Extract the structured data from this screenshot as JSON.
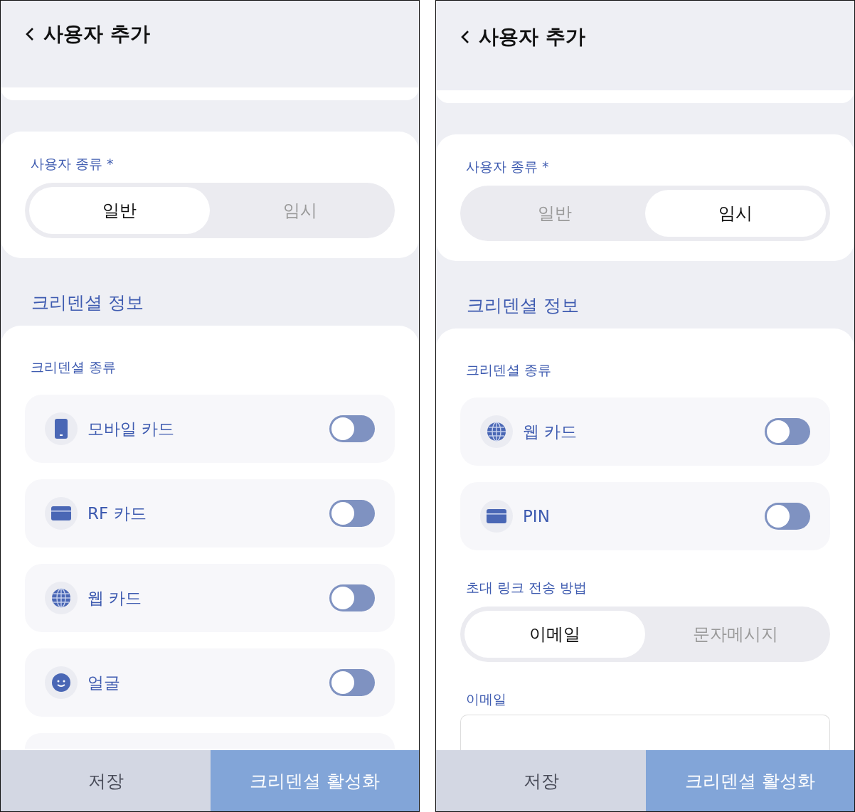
{
  "screens": [
    {
      "title": "사용자 추가",
      "user_type": {
        "label": "사용자 종류 *",
        "options": [
          {
            "label": "일반",
            "selected": true
          },
          {
            "label": "임시",
            "selected": false
          }
        ]
      },
      "section_title": "크리덴셜 정보",
      "credentials": {
        "label": "크리덴셜 종류",
        "more_below": true,
        "items": [
          {
            "kind": "mobile",
            "label": "모바일 카드",
            "on": false
          },
          {
            "kind": "card",
            "label": "RF 카드",
            "on": false
          },
          {
            "kind": "web",
            "label": "웹 카드",
            "on": false
          },
          {
            "kind": "face",
            "label": "얼굴",
            "on": false
          }
        ]
      },
      "buttons": [
        {
          "kind": "secondary",
          "label": "저장"
        },
        {
          "kind": "primary",
          "label": "크리덴셜 활성화"
        }
      ]
    },
    {
      "title": "사용자 추가",
      "user_type": {
        "label": "사용자 종류 *",
        "options": [
          {
            "label": "일반",
            "selected": false
          },
          {
            "label": "임시",
            "selected": true
          }
        ]
      },
      "section_title": "크리덴셜 정보",
      "credentials": {
        "label": "크리덴셜 종류",
        "items": [
          {
            "kind": "web",
            "label": "웹 카드",
            "on": false
          },
          {
            "kind": "card",
            "label": "PIN",
            "on": false
          }
        ]
      },
      "invite": {
        "label": "초대 링크 전송 방법",
        "options": [
          {
            "label": "이메일",
            "selected": true
          },
          {
            "label": "문자메시지",
            "selected": false
          }
        ]
      },
      "email": {
        "label": "이메일"
      },
      "buttons": [
        {
          "kind": "secondary",
          "label": "저장"
        },
        {
          "kind": "primary",
          "label": "크리덴셜 활성화"
        }
      ]
    }
  ]
}
